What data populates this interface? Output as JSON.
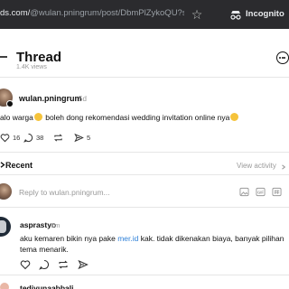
{
  "browser": {
    "url_host": "ds.com/",
    "url_path": "@wulan.pningrum/post/DbmPlZykoQU?sort_or...",
    "incognito_label": "Incognito"
  },
  "header": {
    "title": "Thread",
    "views": "1.4K views"
  },
  "post": {
    "author": "wulan.pningrum",
    "time": "5d",
    "text_part1": "alo warga",
    "text_part2": " boleh dong rekomendasi wedding invitation online nya",
    "likes": "16",
    "comments": "38",
    "shares": "5"
  },
  "recent": {
    "label": "Recent",
    "view_activity": "View activity"
  },
  "reply": {
    "placeholder": "Reply to wulan.pningrum..."
  },
  "comments": [
    {
      "author": "asprastyo",
      "time": "1m",
      "line1_before": "aku kemaren bikin nya pake ",
      "line1_link": "mer.id",
      "line1_after": " kak. tidak dikenakan biaya, banyak pilihan",
      "line2": "tema menarik."
    }
  ],
  "next_comment": {
    "author_partial": "tediyunaabbali"
  },
  "colors": {
    "link": "#2f80d8",
    "muted": "#999999",
    "chrome_bg": "#2b2b2e",
    "emoji": "#f5c33b"
  }
}
